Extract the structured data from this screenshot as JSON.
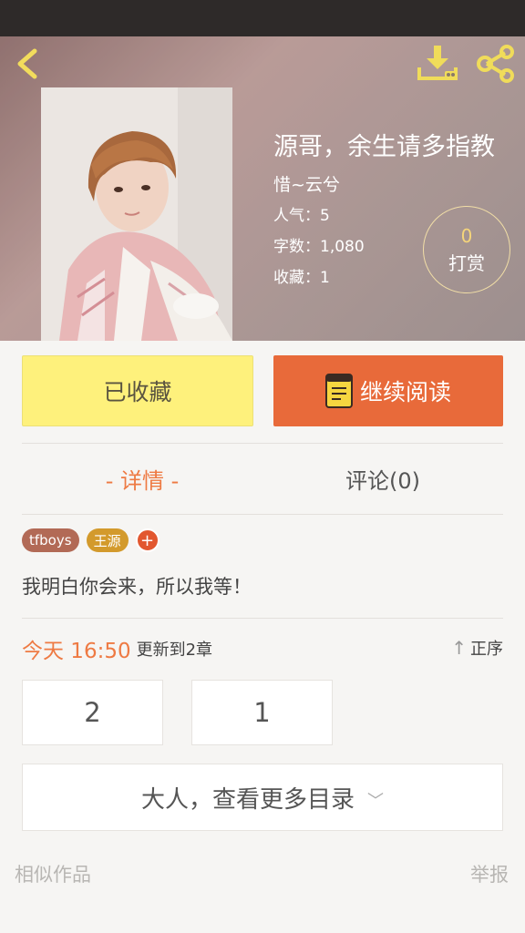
{
  "book": {
    "title": "源哥，余生请多指教",
    "author": "惜~云兮",
    "popularity": "人气：5",
    "word_count": "字数：1,080",
    "favorites": "收藏：1"
  },
  "reward": {
    "count": "0",
    "label": "打赏"
  },
  "actions": {
    "favorited_label": "已收藏",
    "continue_label": "继续阅读"
  },
  "tabs": [
    {
      "label": "- 详情 -",
      "active": true
    },
    {
      "label": "评论(0)",
      "active": false
    }
  ],
  "tags": [
    "tfboys",
    "王源"
  ],
  "tag_add": "+",
  "description": "我明白你会来，所以我等！",
  "update": {
    "time": "今天 16:50",
    "text": "更新到2章"
  },
  "sort_label": "正序",
  "chapters": [
    "2",
    "1"
  ],
  "more_toc_label": "大人，查看更多目录",
  "footer": {
    "similar": "相似作品",
    "report": "举报"
  },
  "colors": {
    "accent": "#ee7a43",
    "favorite_bg": "#fef17c",
    "read_bg": "#e86a3a",
    "icon_yellow": "#f0dc5a"
  }
}
